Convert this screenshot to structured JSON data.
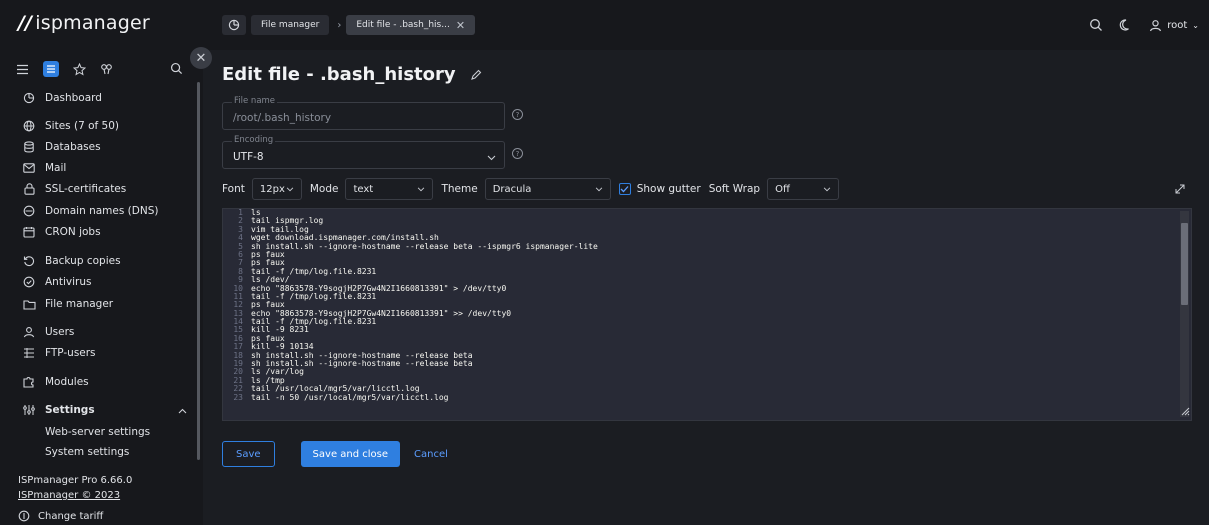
{
  "app": {
    "logo_text": "ispmanager"
  },
  "breadcrumbs": [
    {
      "label": "File manager"
    },
    {
      "label": "Edit file - .bash_his..."
    }
  ],
  "user": {
    "name": "root"
  },
  "sidebar": {
    "items": [
      {
        "label": "Dashboard",
        "icon": "dashboard-icon"
      },
      {
        "label": "Sites (7 of 50)",
        "icon": "globe-icon"
      },
      {
        "label": "Databases",
        "icon": "database-icon"
      },
      {
        "label": "Mail",
        "icon": "mail-icon"
      },
      {
        "label": "SSL-certificates",
        "icon": "lock-icon"
      },
      {
        "label": "Domain names (DNS)",
        "icon": "dns-icon"
      },
      {
        "label": "CRON jobs",
        "icon": "calendar-icon"
      },
      {
        "label": "Backup copies",
        "icon": "backup-icon"
      },
      {
        "label": "Antivirus",
        "icon": "shield-icon"
      },
      {
        "label": "File manager",
        "icon": "folder-icon"
      },
      {
        "label": "Users",
        "icon": "user-icon"
      },
      {
        "label": "FTP-users",
        "icon": "ftp-icon"
      },
      {
        "label": "Modules",
        "icon": "puzzle-icon"
      },
      {
        "label": "Settings",
        "icon": "settings-icon"
      }
    ],
    "subitems": [
      {
        "label": "Web-server settings"
      },
      {
        "label": "System settings"
      }
    ],
    "version": "ISPmanager Pro 6.66.0",
    "copyright": "ISPmanager © 2023",
    "tariff": "Change tariff"
  },
  "page": {
    "title": "Edit file - .bash_history"
  },
  "form": {
    "file_name_label": "File name",
    "file_name_value": "/root/.bash_history",
    "encoding_label": "Encoding",
    "encoding_value": "UTF-8",
    "help_symbol": "?"
  },
  "toolbar": {
    "font_label": "Font",
    "font_value": "12px",
    "mode_label": "Mode",
    "mode_value": "text",
    "theme_label": "Theme",
    "theme_value": "Dracula",
    "show_gutter_label": "Show gutter",
    "show_gutter_checked": true,
    "soft_wrap_label": "Soft Wrap",
    "soft_wrap_value": "Off"
  },
  "editor": {
    "colors": {
      "background": "#282a36",
      "text": "#f8f8f2",
      "gutter": "#6d7286"
    },
    "lines": [
      {
        "n": "1",
        "text": "ls"
      },
      {
        "n": "2",
        "text": "tail ispmgr.log"
      },
      {
        "n": "3",
        "text": "vim tail.log"
      },
      {
        "n": "4",
        "text": "wget download.ispmanager.com/install.sh"
      },
      {
        "n": "5",
        "text": "sh install.sh --ignore-hostname --release beta --ispmgr6 ispmanager-lite"
      },
      {
        "n": "6",
        "text": "ps faux"
      },
      {
        "n": "7",
        "text": "ps faux"
      },
      {
        "n": "8",
        "text": "tail -f /tmp/log.file.8231"
      },
      {
        "n": "9",
        "text": "ls /dev/"
      },
      {
        "n": "10",
        "text": "echo \"8863578-Y9sogjH2P7Gw4N2I1660813391\" > /dev/tty0"
      },
      {
        "n": "11",
        "text": "tail -f /tmp/log.file.8231"
      },
      {
        "n": "12",
        "text": "ps faux"
      },
      {
        "n": "13",
        "text": "echo \"8863578-Y9sogjH2P7Gw4N2I1660813391\" >> /dev/tty0"
      },
      {
        "n": "14",
        "text": "tail -f /tmp/log.file.8231"
      },
      {
        "n": "15",
        "text": "kill -9 8231"
      },
      {
        "n": "16",
        "text": "ps faux"
      },
      {
        "n": "17",
        "text": "kill -9 10134"
      },
      {
        "n": "18",
        "text": "sh install.sh --ignore-hostname --release beta"
      },
      {
        "n": "19",
        "text": "sh install.sh --ignore-hostname --release beta"
      },
      {
        "n": "20",
        "text": "ls /var/log"
      },
      {
        "n": "21",
        "text": "ls /tmp"
      },
      {
        "n": "22",
        "text": "tail /usr/local/mgr5/var/licctl.log"
      },
      {
        "n": "23",
        "text": "tail -n 50 /usr/local/mgr5/var/licctl.log"
      }
    ]
  },
  "actions": {
    "save": "Save",
    "save_close": "Save and close",
    "cancel": "Cancel"
  },
  "colors": {
    "accent": "#2f7fe0",
    "background": "#1b1d22",
    "panel": "#17181c"
  }
}
